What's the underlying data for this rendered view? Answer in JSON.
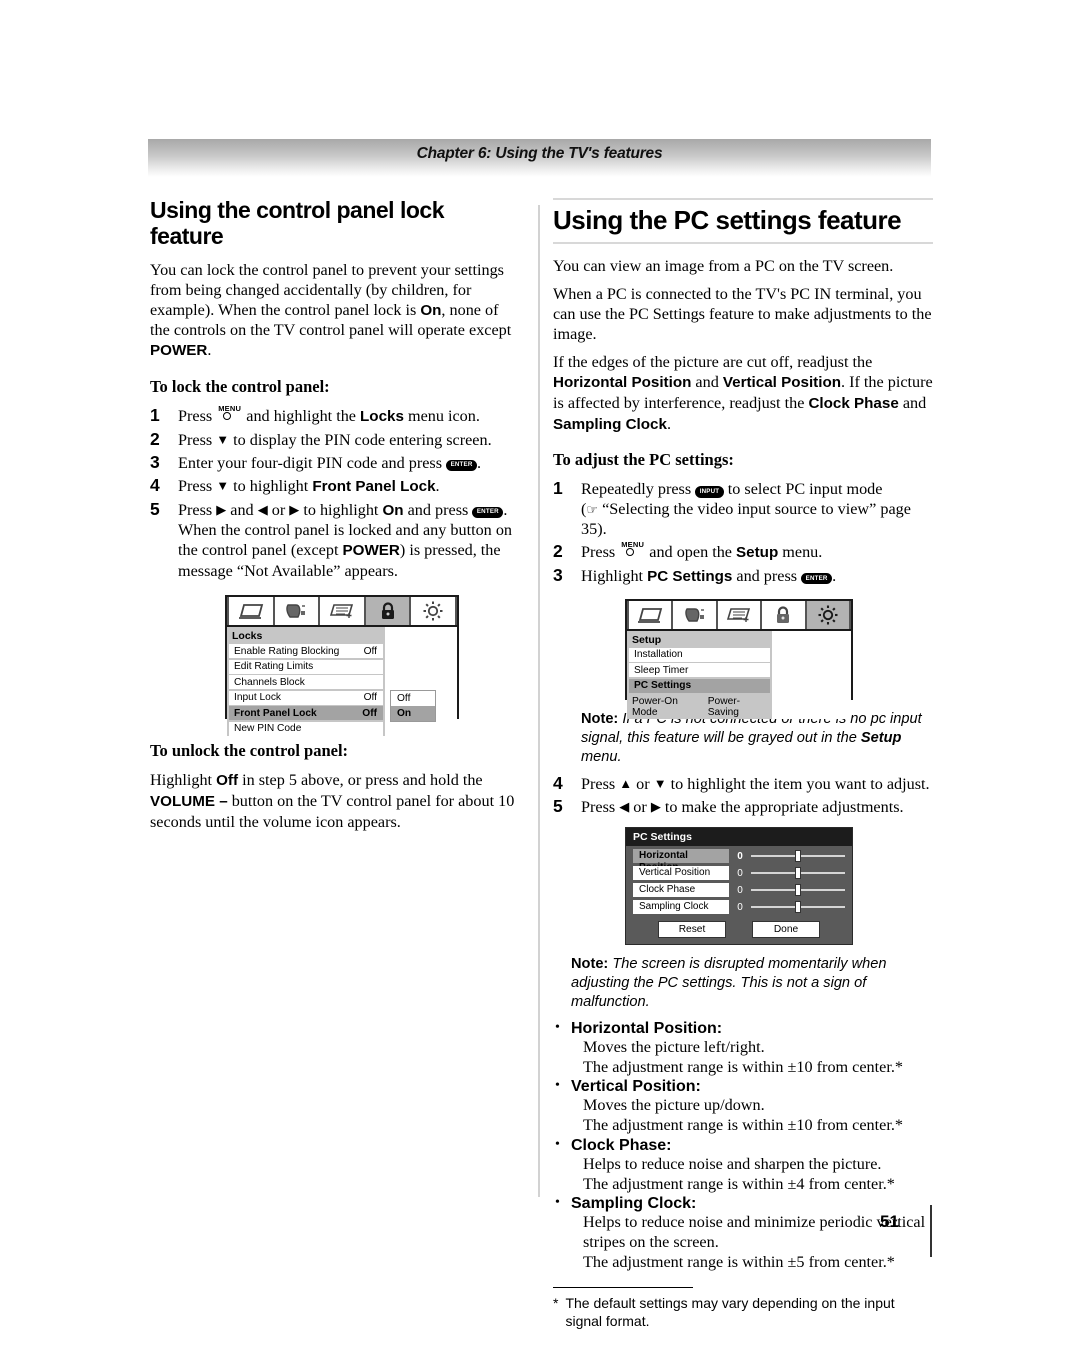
{
  "header": {
    "chapter_title": "Chapter 6: Using the TV's features"
  },
  "page_number": "51",
  "left_column": {
    "heading": "Using the control panel lock feature",
    "intro_1": "You can lock the control panel to prevent your settings from being changed accidentally (by children, for example). When the control panel lock is ",
    "intro_on": "On",
    "intro_2": ", none of the controls on the TV control panel will operate except ",
    "intro_power": "POWER",
    "intro_3": ".",
    "lock_subhead": "To lock the control panel:",
    "steps": [
      {
        "pre": "Press ",
        "key": "MENU",
        "post": " and highlight the ",
        "bold": "Locks",
        "tail": " menu icon."
      },
      {
        "pre": "Press ",
        "arrow": "▼",
        "post": " to display the PIN code entering screen.",
        "bold": "",
        "tail": ""
      },
      {
        "pre": "Enter your four-digit PIN code and press ",
        "key": "ENTER",
        "post": ".",
        "bold": "",
        "tail": ""
      },
      {
        "pre": "Press ",
        "arrow": "▼",
        "post": " to highlight ",
        "bold": "Front Panel Lock",
        "tail": "."
      }
    ],
    "step5": {
      "a": "Press ",
      "arrow1": "▶",
      "b": " and ",
      "arrow2": "◀",
      "c": " or ",
      "arrow3": "▶",
      "d": " to highlight ",
      "on": "On",
      "e": " and press ",
      "key": "ENTER",
      "f": ". When the control panel is locked and any button on the control panel (except ",
      "power": "POWER",
      "g": ") is pressed, the message “Not Available” appears."
    },
    "unlock_subhead": "To unlock the control panel:",
    "unlock_a": "Highlight ",
    "unlock_off": "Off",
    "unlock_b": " in step 5 above, or press and hold the ",
    "unlock_volume": "VOLUME –",
    "unlock_c": " button on the TV control panel for about 10 seconds until the volume icon appears."
  },
  "locks_osd": {
    "icons": [
      "picture-icon",
      "audio-icon",
      "settings-sliders-icon",
      "lock-icon",
      "setup-sun-icon"
    ],
    "selected_icon_index": 3,
    "menu_title": "Locks",
    "rows": [
      {
        "label": "Enable Rating Blocking",
        "value": "Off",
        "highlight": false
      },
      {
        "label": "Edit Rating Limits",
        "value": "",
        "highlight": false
      },
      {
        "label": "Channels Block",
        "value": "",
        "highlight": false
      },
      {
        "label": "Input Lock",
        "value": "Off",
        "highlight": false
      },
      {
        "label": "Front Panel Lock",
        "value": "Off",
        "highlight": true
      },
      {
        "label": "New PIN Code",
        "value": "",
        "highlight": false
      }
    ],
    "popup": [
      {
        "label": "Off",
        "selected": false
      },
      {
        "label": "On",
        "selected": true
      }
    ]
  },
  "right_column": {
    "heading": "Using the PC settings feature",
    "para_1": "You can view an image from a PC on the TV screen.",
    "para_2": "When a PC is connected to the TV's PC IN terminal, you can use the PC Settings feature to make adjustments to the image.",
    "para_3_a": "If the edges of the picture are cut off, readjust the ",
    "para_3_b1": "Horizontal Position",
    "para_3_c": " and ",
    "para_3_b2": "Vertical Position",
    "para_3_d": ". If the picture is affected by interference, readjust the ",
    "para_3_b3": "Clock Phase",
    "para_3_e": " and ",
    "para_3_b4": "Sampling Clock",
    "para_3_f": ".",
    "adjust_subhead": "To adjust the PC settings:",
    "step1": {
      "a": "Repeatedly press ",
      "key": "INPUT",
      "b": " to select PC input mode",
      "ref_open": "(",
      "ref_hand": "☞",
      "ref_text": " “Selecting the video input source to view” page 35)."
    },
    "step2": {
      "a": "Press ",
      "key": "MENU",
      "b": " and open the ",
      "bold": "Setup",
      "c": " menu."
    },
    "step3": {
      "a": "Highlight ",
      "bold": "PC Settings",
      "b": " and press ",
      "key": "ENTER",
      "c": "."
    },
    "note_1_label": "Note:",
    "note_1_a": " If a PC is not connected or there is no pc input signal, this feature will be grayed out in the ",
    "note_1_bold": "Setup",
    "note_1_b": " menu.",
    "step4": {
      "a": "Press ",
      "arrow1": "▲",
      "b": " or ",
      "arrow2": "▼",
      "c": " to highlight the item you want to adjust."
    },
    "step5": {
      "a": "Press ",
      "arrow1": "◀",
      "b": " or ",
      "arrow2": "▶",
      "c": " to make the appropriate adjustments."
    },
    "note_2_label": "Note:",
    "note_2_text": " The screen is disrupted momentarily when adjusting the PC settings. This is not a sign of malfunction.",
    "bullets": [
      {
        "term": "Horizontal Position:",
        "desc": "Moves the picture left/right.\nThe adjustment range is within ±10 from center.*"
      },
      {
        "term": "Vertical Position:",
        "desc": "Moves the picture up/down.\nThe adjustment range is within ±10 from center.*"
      },
      {
        "term": "Clock Phase:",
        "desc": "Helps to reduce noise and sharpen the picture.\nThe adjustment range is within ±4 from center.*"
      },
      {
        "term": "Sampling Clock:",
        "desc": "Helps to reduce noise and minimize periodic vertical stripes on the screen.\nThe adjustment range is within ±5 from center.*"
      }
    ],
    "footnote_marker": "*",
    "footnote_text": "The default settings may vary depending on the input signal format."
  },
  "setup_osd": {
    "icons": [
      "picture-icon",
      "audio-icon",
      "settings-sliders-icon",
      "lock-icon",
      "setup-sun-icon"
    ],
    "selected_icon_index": 4,
    "menu_title": "Setup",
    "rows": [
      {
        "label": "Installation",
        "value": "",
        "highlight": false,
        "plain": false
      },
      {
        "label": "Sleep Timer",
        "value": "",
        "highlight": false,
        "plain": false
      },
      {
        "label": "PC Settings",
        "value": "",
        "highlight": true,
        "plain": false
      },
      {
        "label": "Power-On Mode",
        "value": "Power-Saving",
        "highlight": false,
        "plain": true
      }
    ]
  },
  "pc_settings_dialog": {
    "title": "PC Settings",
    "sliders": [
      {
        "label": "Horizontal Position",
        "value": "0",
        "active": true
      },
      {
        "label": "Vertical Position",
        "value": "0",
        "active": false
      },
      {
        "label": "Clock Phase",
        "value": "0",
        "active": false
      },
      {
        "label": "Sampling Clock",
        "value": "0",
        "active": false
      }
    ],
    "buttons": [
      {
        "label": "Reset"
      },
      {
        "label": "Done"
      }
    ]
  }
}
